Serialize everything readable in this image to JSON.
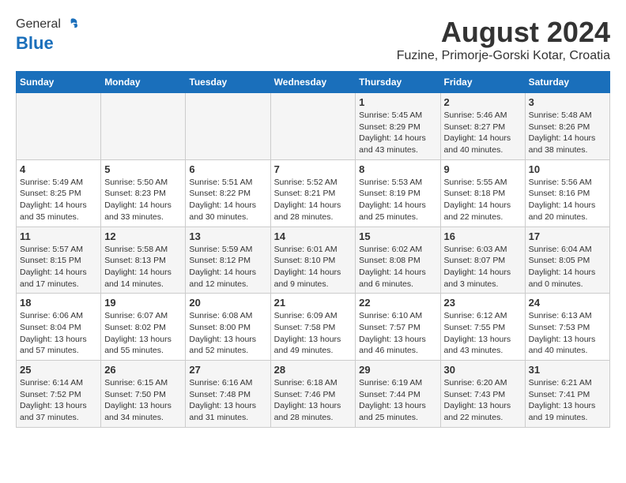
{
  "header": {
    "logo_general": "General",
    "logo_blue": "Blue",
    "title": "August 2024",
    "subtitle": "Fuzine, Primorje-Gorski Kotar, Croatia"
  },
  "days_of_week": [
    "Sunday",
    "Monday",
    "Tuesday",
    "Wednesday",
    "Thursday",
    "Friday",
    "Saturday"
  ],
  "weeks": [
    [
      {
        "day": "",
        "info": ""
      },
      {
        "day": "",
        "info": ""
      },
      {
        "day": "",
        "info": ""
      },
      {
        "day": "",
        "info": ""
      },
      {
        "day": "1",
        "info": "Sunrise: 5:45 AM\nSunset: 8:29 PM\nDaylight: 14 hours\nand 43 minutes."
      },
      {
        "day": "2",
        "info": "Sunrise: 5:46 AM\nSunset: 8:27 PM\nDaylight: 14 hours\nand 40 minutes."
      },
      {
        "day": "3",
        "info": "Sunrise: 5:48 AM\nSunset: 8:26 PM\nDaylight: 14 hours\nand 38 minutes."
      }
    ],
    [
      {
        "day": "4",
        "info": "Sunrise: 5:49 AM\nSunset: 8:25 PM\nDaylight: 14 hours\nand 35 minutes."
      },
      {
        "day": "5",
        "info": "Sunrise: 5:50 AM\nSunset: 8:23 PM\nDaylight: 14 hours\nand 33 minutes."
      },
      {
        "day": "6",
        "info": "Sunrise: 5:51 AM\nSunset: 8:22 PM\nDaylight: 14 hours\nand 30 minutes."
      },
      {
        "day": "7",
        "info": "Sunrise: 5:52 AM\nSunset: 8:21 PM\nDaylight: 14 hours\nand 28 minutes."
      },
      {
        "day": "8",
        "info": "Sunrise: 5:53 AM\nSunset: 8:19 PM\nDaylight: 14 hours\nand 25 minutes."
      },
      {
        "day": "9",
        "info": "Sunrise: 5:55 AM\nSunset: 8:18 PM\nDaylight: 14 hours\nand 22 minutes."
      },
      {
        "day": "10",
        "info": "Sunrise: 5:56 AM\nSunset: 8:16 PM\nDaylight: 14 hours\nand 20 minutes."
      }
    ],
    [
      {
        "day": "11",
        "info": "Sunrise: 5:57 AM\nSunset: 8:15 PM\nDaylight: 14 hours\nand 17 minutes."
      },
      {
        "day": "12",
        "info": "Sunrise: 5:58 AM\nSunset: 8:13 PM\nDaylight: 14 hours\nand 14 minutes."
      },
      {
        "day": "13",
        "info": "Sunrise: 5:59 AM\nSunset: 8:12 PM\nDaylight: 14 hours\nand 12 minutes."
      },
      {
        "day": "14",
        "info": "Sunrise: 6:01 AM\nSunset: 8:10 PM\nDaylight: 14 hours\nand 9 minutes."
      },
      {
        "day": "15",
        "info": "Sunrise: 6:02 AM\nSunset: 8:08 PM\nDaylight: 14 hours\nand 6 minutes."
      },
      {
        "day": "16",
        "info": "Sunrise: 6:03 AM\nSunset: 8:07 PM\nDaylight: 14 hours\nand 3 minutes."
      },
      {
        "day": "17",
        "info": "Sunrise: 6:04 AM\nSunset: 8:05 PM\nDaylight: 14 hours\nand 0 minutes."
      }
    ],
    [
      {
        "day": "18",
        "info": "Sunrise: 6:06 AM\nSunset: 8:04 PM\nDaylight: 13 hours\nand 57 minutes."
      },
      {
        "day": "19",
        "info": "Sunrise: 6:07 AM\nSunset: 8:02 PM\nDaylight: 13 hours\nand 55 minutes."
      },
      {
        "day": "20",
        "info": "Sunrise: 6:08 AM\nSunset: 8:00 PM\nDaylight: 13 hours\nand 52 minutes."
      },
      {
        "day": "21",
        "info": "Sunrise: 6:09 AM\nSunset: 7:58 PM\nDaylight: 13 hours\nand 49 minutes."
      },
      {
        "day": "22",
        "info": "Sunrise: 6:10 AM\nSunset: 7:57 PM\nDaylight: 13 hours\nand 46 minutes."
      },
      {
        "day": "23",
        "info": "Sunrise: 6:12 AM\nSunset: 7:55 PM\nDaylight: 13 hours\nand 43 minutes."
      },
      {
        "day": "24",
        "info": "Sunrise: 6:13 AM\nSunset: 7:53 PM\nDaylight: 13 hours\nand 40 minutes."
      }
    ],
    [
      {
        "day": "25",
        "info": "Sunrise: 6:14 AM\nSunset: 7:52 PM\nDaylight: 13 hours\nand 37 minutes."
      },
      {
        "day": "26",
        "info": "Sunrise: 6:15 AM\nSunset: 7:50 PM\nDaylight: 13 hours\nand 34 minutes."
      },
      {
        "day": "27",
        "info": "Sunrise: 6:16 AM\nSunset: 7:48 PM\nDaylight: 13 hours\nand 31 minutes."
      },
      {
        "day": "28",
        "info": "Sunrise: 6:18 AM\nSunset: 7:46 PM\nDaylight: 13 hours\nand 28 minutes."
      },
      {
        "day": "29",
        "info": "Sunrise: 6:19 AM\nSunset: 7:44 PM\nDaylight: 13 hours\nand 25 minutes."
      },
      {
        "day": "30",
        "info": "Sunrise: 6:20 AM\nSunset: 7:43 PM\nDaylight: 13 hours\nand 22 minutes."
      },
      {
        "day": "31",
        "info": "Sunrise: 6:21 AM\nSunset: 7:41 PM\nDaylight: 13 hours\nand 19 minutes."
      }
    ]
  ]
}
